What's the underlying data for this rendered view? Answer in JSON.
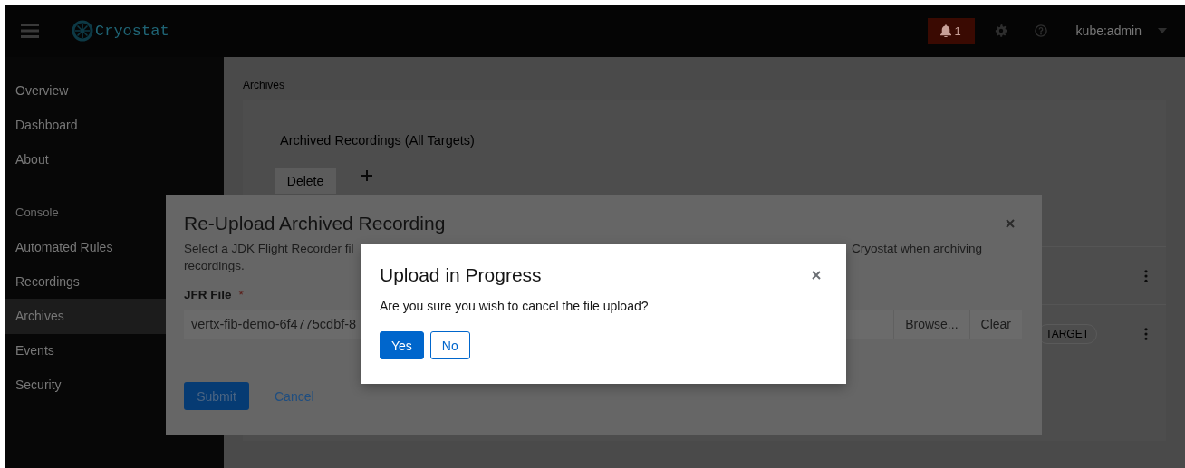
{
  "header": {
    "brand": "Cryostat",
    "notification_count": "1",
    "user": "kube:admin"
  },
  "sidebar": {
    "groups": [
      {
        "items": [
          {
            "label": "Overview",
            "selected": false
          },
          {
            "label": "Dashboard",
            "selected": false
          },
          {
            "label": "About",
            "selected": false
          }
        ]
      },
      {
        "title": "Console",
        "items": [
          {
            "label": "Automated Rules",
            "selected": false
          },
          {
            "label": "Recordings",
            "selected": false
          },
          {
            "label": "Archives",
            "selected": true
          },
          {
            "label": "Events",
            "selected": false
          },
          {
            "label": "Security",
            "selected": false
          }
        ]
      }
    ]
  },
  "main": {
    "breadcrumb": "Archives",
    "card_title": "Archived Recordings (All Targets)",
    "delete_button": {
      "label": "Delete"
    },
    "rows": [
      {
        "kind": "plain"
      },
      {
        "kind": "labeled",
        "label": "TARGET"
      }
    ]
  },
  "upload_modal": {
    "title": "Re-Upload Archived Recording",
    "description_parts": [
      "Select a JDK Flight Recorder fil",
      "Cryostat when archiving",
      "recordings."
    ],
    "field_label": "JFR File",
    "required_mark": "*",
    "file_value": "vertx-fib-demo-6f4775cdbf-8",
    "browse_button": "Browse...",
    "clear_button": "Clear",
    "submit_button": "Submit",
    "cancel_button": "Cancel"
  },
  "confirm_modal": {
    "title": "Upload in Progress",
    "message": "Are you sure you wish to cancel the file upload?",
    "buttons": [
      {
        "label": "Yes",
        "kind": "primary"
      },
      {
        "label": "No",
        "kind": "secondary"
      }
    ]
  }
}
